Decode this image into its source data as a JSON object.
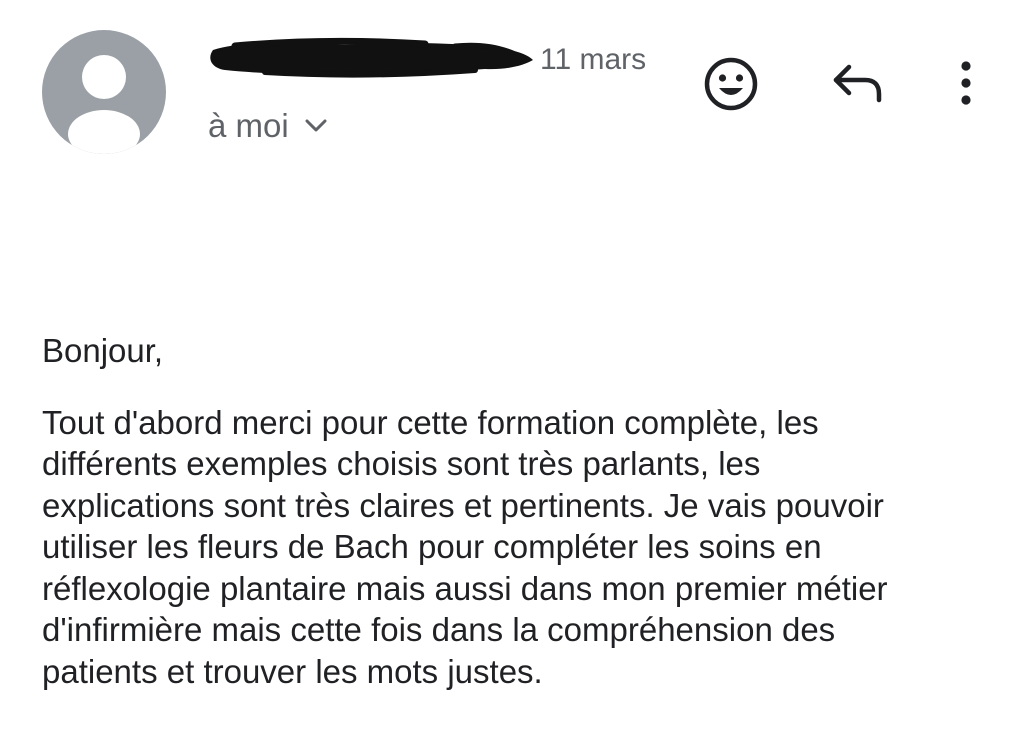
{
  "header": {
    "date": "11 mars",
    "recipient_label": "à moi",
    "icons": {
      "avatar": "person-silhouette-icon",
      "recipient_toggle": "chevron-down-icon",
      "emoji": "smiley-face-icon",
      "reply": "reply-arrow-icon",
      "more": "more-vertical-icon"
    },
    "colors": {
      "avatar_bg": "#9aa0a6",
      "meta_text": "#5f6368",
      "body_text": "#202124",
      "redaction": "#111111"
    }
  },
  "message": {
    "greeting": "Bonjour,",
    "paragraph": "Tout d'abord merci pour cette formation complète,  les\ndifférents exemples choisis sont très parlants, les\nexplications sont très claires et pertinents. Je vais pouvoir\nutiliser les fleurs de Bach pour compléter les soins en\nréflexologie plantaire mais aussi dans mon premier métier\nd'infirmière mais cette fois dans la compréhension des\npatients et trouver les mots justes."
  }
}
